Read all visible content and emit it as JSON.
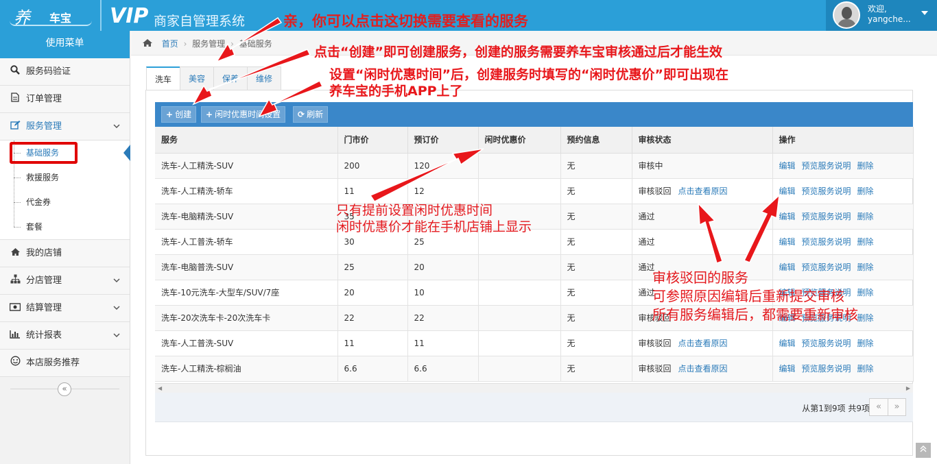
{
  "header": {
    "logo_mark": "养",
    "logo_text": "车宝",
    "vip": "VIP",
    "system_name": "商家自管理系统",
    "welcome": "欢迎,",
    "username": "yangche..."
  },
  "sidebar": {
    "menu_title": "使用菜单",
    "items": [
      {
        "label": "服务码验证",
        "icon": "search-icon"
      },
      {
        "label": "订单管理",
        "icon": "document-icon"
      },
      {
        "label": "服务管理",
        "icon": "edit-icon"
      },
      {
        "label": "我的店铺",
        "icon": "home-icon"
      },
      {
        "label": "分店管理",
        "icon": "sitemap-icon"
      },
      {
        "label": "结算管理",
        "icon": "money-icon"
      },
      {
        "label": "统计报表",
        "icon": "bar-chart-icon"
      },
      {
        "label": "本店服务推荐",
        "icon": "smile-icon"
      }
    ],
    "submenu": [
      "基础服务",
      "救援服务",
      "代金券",
      "套餐"
    ]
  },
  "breadcrumb": [
    "首页",
    "服务管理",
    "基础服务"
  ],
  "tabs": [
    "洗车",
    "美容",
    "保养",
    "维修"
  ],
  "toolbar": {
    "create": "创建",
    "idle_setting": "闲时优惠时间设置",
    "refresh": "刷新"
  },
  "table": {
    "columns": [
      "服务",
      "门市价",
      "预订价",
      "闲时优惠价",
      "预约信息",
      "审核状态",
      "操作"
    ],
    "actions": [
      "编辑",
      "预览服务说明",
      "删除"
    ],
    "reason_link": "点击查看原因",
    "rows": [
      {
        "service": "洗车-人工精洗-SUV",
        "market": "200",
        "booking": "120",
        "idle": "",
        "info": "无",
        "status": "审核中",
        "reason": ""
      },
      {
        "service": "洗车-人工精洗-轿车",
        "market": "11",
        "booking": "12",
        "idle": "",
        "info": "无",
        "status": "审核驳回",
        "reason": "点击查看原因"
      },
      {
        "service": "洗车-电脑精洗-SUV",
        "market": "35",
        "booking": "",
        "idle": "",
        "info": "无",
        "status": "通过",
        "reason": ""
      },
      {
        "service": "洗车-人工普洗-轿车",
        "market": "30",
        "booking": "25",
        "idle": "",
        "info": "无",
        "status": "通过",
        "reason": ""
      },
      {
        "service": "洗车-电脑普洗-SUV",
        "market": "25",
        "booking": "20",
        "idle": "",
        "info": "无",
        "status": "通过",
        "reason": ""
      },
      {
        "service": "洗车-10元洗车-大型车/SUV/7座",
        "market": "20",
        "booking": "10",
        "idle": "",
        "info": "无",
        "status": "通过",
        "reason": ""
      },
      {
        "service": "洗车-20次洗车卡-20次洗车卡",
        "market": "22",
        "booking": "22",
        "idle": "",
        "info": "无",
        "status": "审核驳回",
        "reason": ""
      },
      {
        "service": "洗车-人工普洗-SUV",
        "market": "11",
        "booking": "11",
        "idle": "",
        "info": "无",
        "status": "审核驳回",
        "reason": "点击查看原因"
      },
      {
        "service": "洗车-人工精洗-棕榈油",
        "market": "6.6",
        "booking": "6.6",
        "idle": "",
        "info": "无",
        "status": "审核驳回",
        "reason": "点击查看原因"
      }
    ]
  },
  "pagination": {
    "info": "从第1到9项 共9项",
    "prev": "«",
    "next": "»"
  },
  "annotations": {
    "switch_tip": "亲，你可以点击这切换需要查看的服务",
    "create_tip": "点击“创建”即可创建服务，创建的服务需要养车宝审核通过后才能生效",
    "idle_tip_1": "设置“闲时优惠时间”后，创建服务时填写的“闲时优惠价”即可出现在",
    "idle_tip_2": "养车宝的手机APP上了",
    "idle_price_1": "只有提前设置闲时优惠时间",
    "idle_price_2": "闲时优惠价才能在手机店铺上显示",
    "rejected_1": "审核驳回的服务",
    "rejected_2": "可参照原因编辑后重新提交审核",
    "rejected_3": "所有服务编辑后，都需要重新审核"
  },
  "colors": {
    "brand_blue": "#2b9fd8",
    "toolbar_blue": "#3a87c9",
    "link_blue": "#2b7bb9",
    "annotation_red": "#e8171b"
  }
}
